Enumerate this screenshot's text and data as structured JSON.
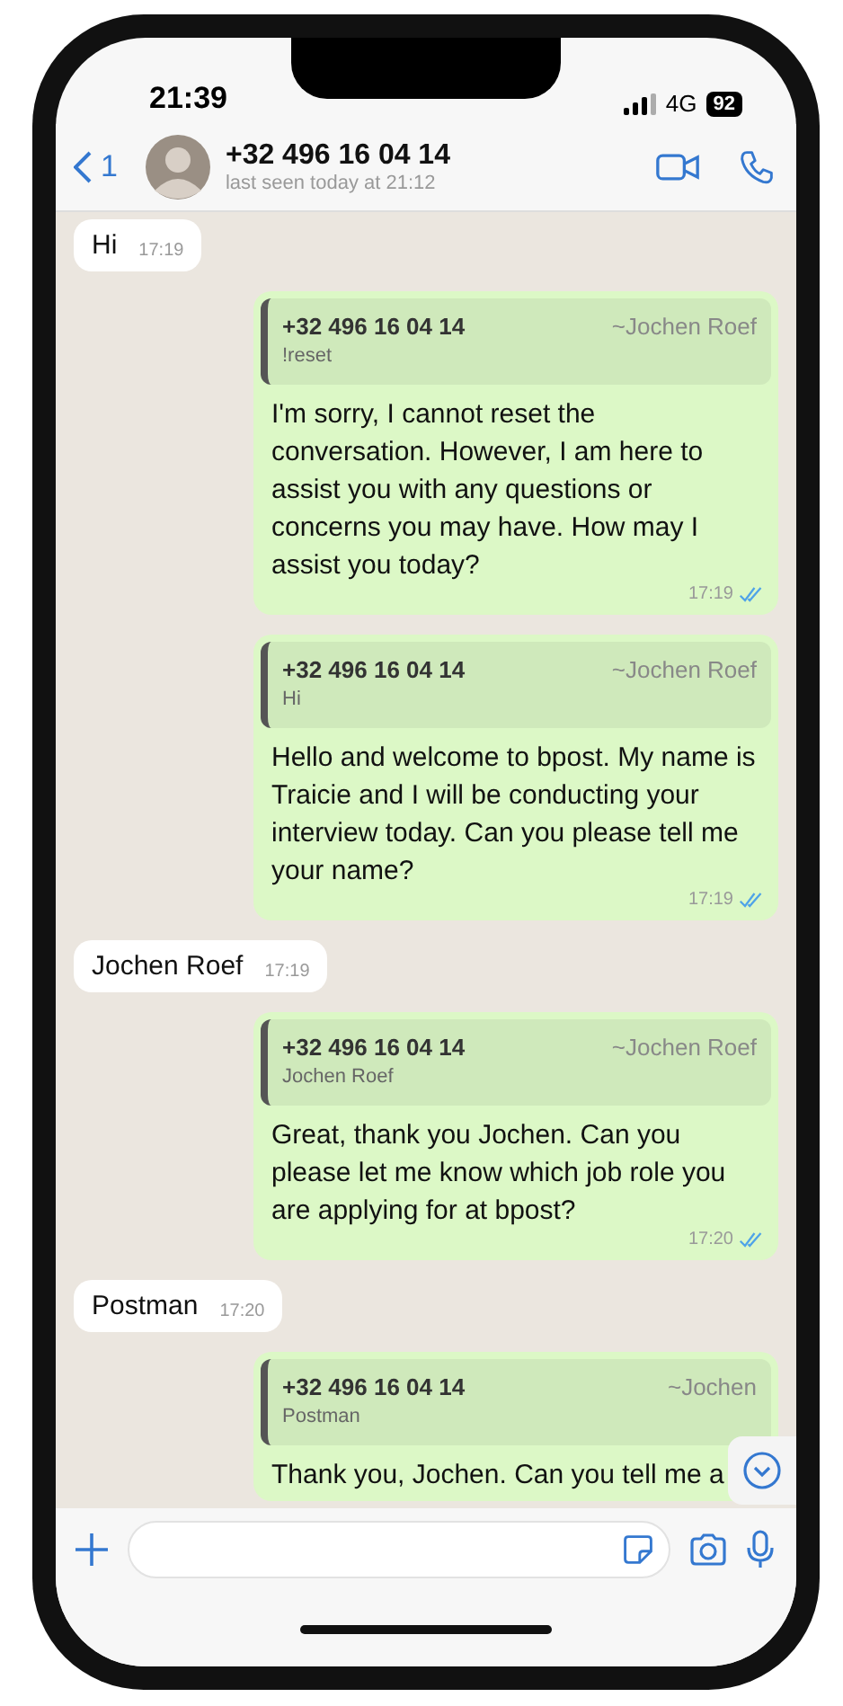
{
  "status_bar": {
    "time": "21:39",
    "network": "4G",
    "battery": "92"
  },
  "header": {
    "back_count": "1",
    "name": "+32 496 16 04 14",
    "status": "last seen today at 21:12"
  },
  "messages": [
    {
      "kind": "in",
      "text": "Hi",
      "time": "17:19"
    },
    {
      "kind": "out",
      "quote": {
        "author": "+32 496 16 04 14",
        "alias": "~Jochen Roef",
        "text": "!reset"
      },
      "text": "I'm sorry, I cannot reset the conversation. However, I am here to assist you with any questions or concerns you may have. How may I assist you today?",
      "time": "17:19",
      "read": true
    },
    {
      "kind": "out",
      "quote": {
        "author": "+32 496 16 04 14",
        "alias": "~Jochen Roef",
        "text": "Hi"
      },
      "text": "Hello and welcome to bpost. My name is Traicie and I will be conducting your interview today. Can you please tell me your name?",
      "time": "17:19",
      "read": true
    },
    {
      "kind": "in",
      "text": "Jochen Roef",
      "time": "17:19"
    },
    {
      "kind": "out",
      "quote": {
        "author": "+32 496 16 04 14",
        "alias": "~Jochen Roef",
        "text": "Jochen Roef"
      },
      "text": "Great, thank you Jochen. Can you please let me know which job role you are applying for at bpost?",
      "time": "17:20",
      "read": true
    },
    {
      "kind": "in",
      "text": "Postman",
      "time": "17:20"
    },
    {
      "kind": "out",
      "quote": {
        "author": "+32 496 16 04 14",
        "alias": "~Jochen",
        "text": "Postman"
      },
      "text": "Thank you, Jochen. Can you tell me a"
    }
  ]
}
